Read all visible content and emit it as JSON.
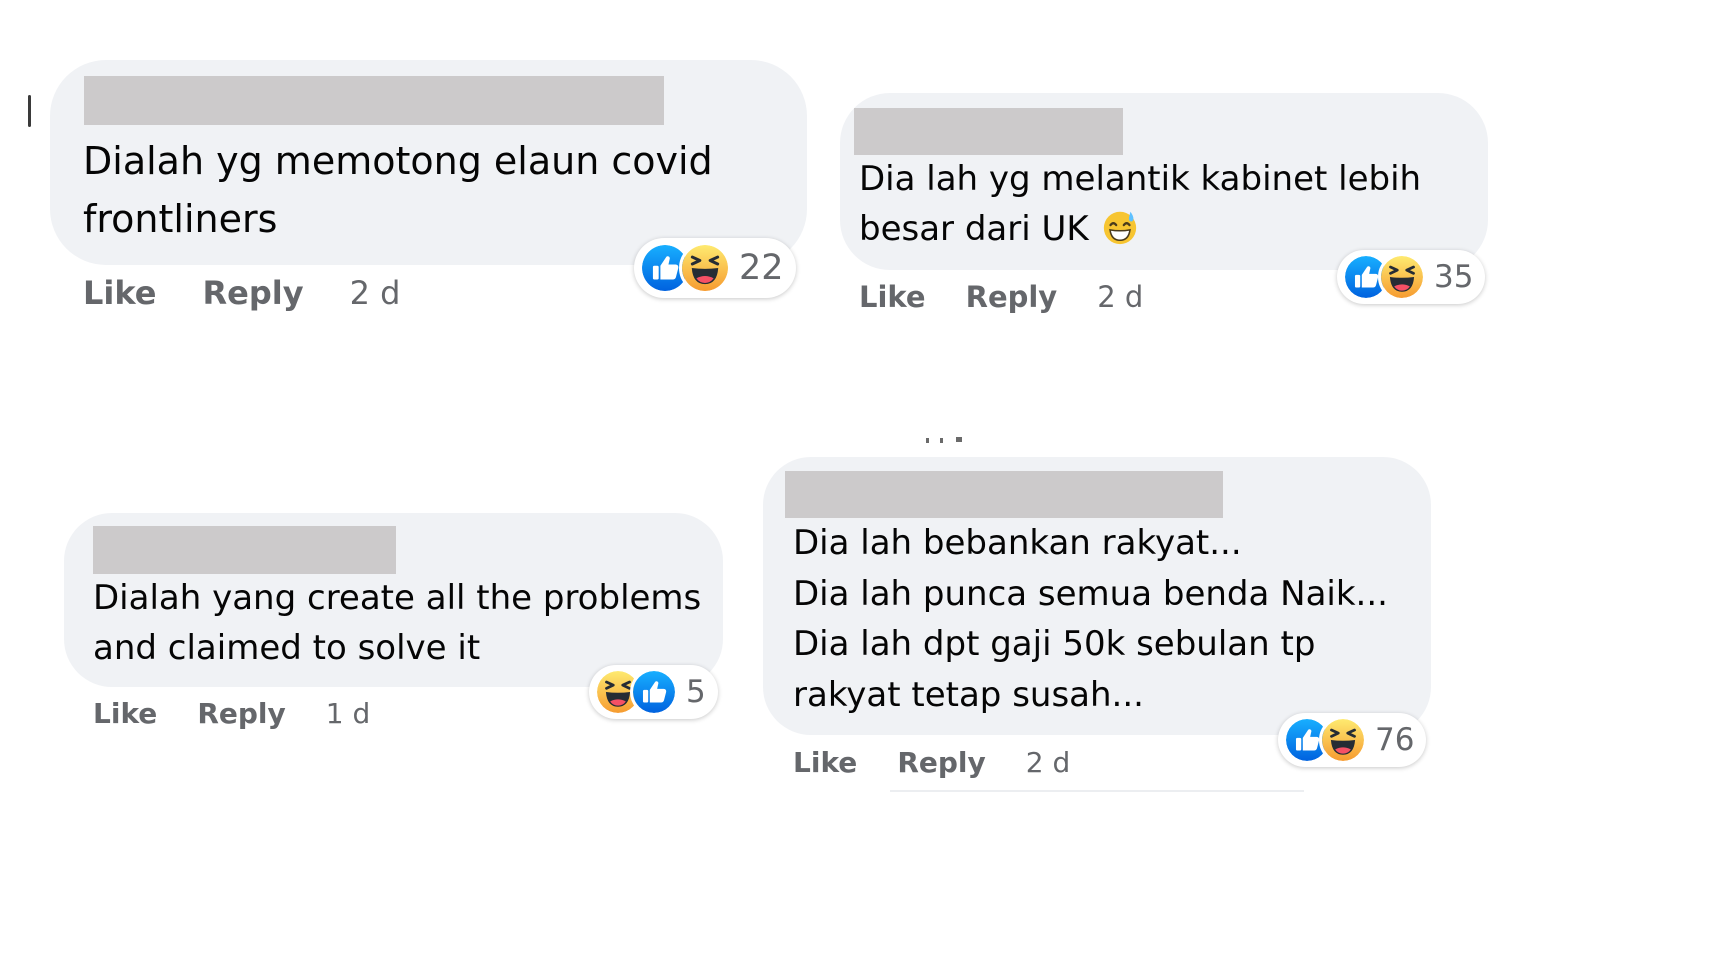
{
  "actions": {
    "like": "Like",
    "reply": "Reply"
  },
  "colors": {
    "bubble": "#f0f2f5",
    "redaction": "#cccacb",
    "secondary_text": "#65676b",
    "like_blue": "#1877f2",
    "haha_yellow": "#f7b125"
  },
  "comments": [
    {
      "text": "Dialah yg memotong elaun covid\nfrontliners",
      "time": "2 d",
      "reaction_icons": [
        "like-icon",
        "haha-icon"
      ],
      "reaction_count": "22"
    },
    {
      "text": "Dia lah yg melantik kabinet lebih\nbesar dari UK",
      "emoji": "grinning-sweat-emoji",
      "time": "2 d",
      "reaction_icons": [
        "like-icon",
        "haha-icon"
      ],
      "reaction_count": "35"
    },
    {
      "text": "Dialah yang create all the problems\nand claimed to solve it",
      "time": "1 d",
      "reaction_icons": [
        "haha-icon",
        "like-icon"
      ],
      "reaction_count": "5"
    },
    {
      "text": "Dia lah bebankan rakyat...\nDia lah punca semua benda Naik...\nDia lah dpt gaji 50k sebulan tp\nrakyat tetap susah...",
      "time": "2 d",
      "reaction_icons": [
        "like-icon",
        "haha-icon"
      ],
      "reaction_count": "76"
    }
  ]
}
